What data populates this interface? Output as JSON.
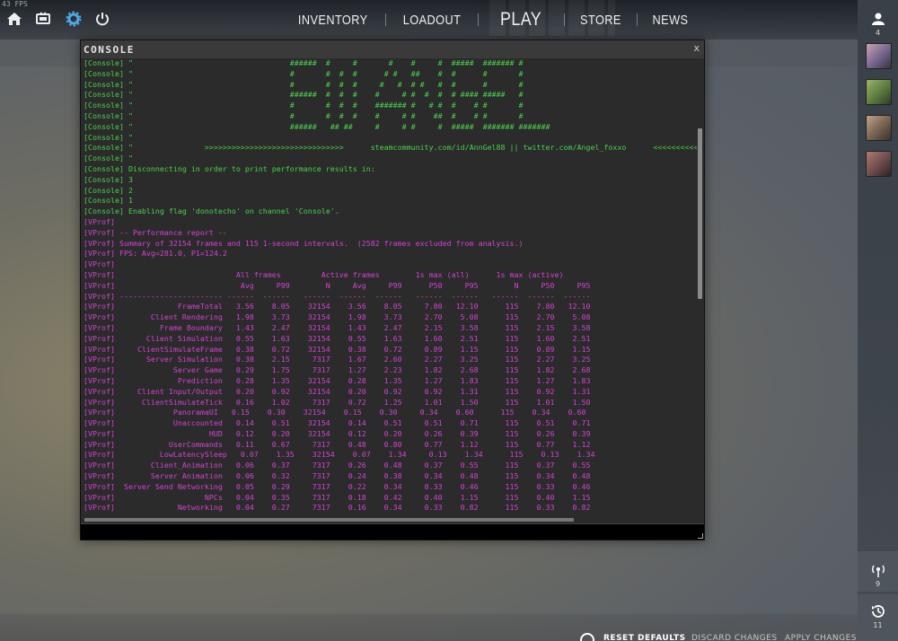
{
  "fps": "43 FPS",
  "nav": {
    "inventory": "INVENTORY",
    "loadout": "LOADOUT",
    "play": "PLAY",
    "store": "STORE",
    "news": "NEWS"
  },
  "topbar_icons": [
    "home-icon",
    "tv-icon",
    "gear-icon",
    "power-icon"
  ],
  "sidebar": {
    "friends_count": "4",
    "network_count": "9",
    "history_count": "11"
  },
  "console": {
    "title": "CONSOLE",
    "close": "x",
    "lines": [
      {
        "t": "c",
        "s": "[Console] \"                                   ######  #     #       #    #     #  #####  ####### #"
      },
      {
        "t": "c",
        "s": "[Console] \"                                   #       #  #  #      # #   ##    #  #      #       #"
      },
      {
        "t": "c",
        "s": "[Console] \"                                   #       #  #  #     #   #  # #   #  #      #       #"
      },
      {
        "t": "c",
        "s": "[Console] \"                                   ######  #  #  #    #     # #  #  #  # #### #####   #"
      },
      {
        "t": "c",
        "s": "[Console] \"                                   #       #  #  #    ####### #   # #  #    # #       #"
      },
      {
        "t": "c",
        "s": "[Console] \"                                   #       #  #  #    #     # #    ##  #    # #       #"
      },
      {
        "t": "c",
        "s": "[Console] \"                                   ######   ## ##     #     # #     #  #####  ####### #######"
      },
      {
        "t": "c",
        "s": "[Console] \""
      },
      {
        "t": "c",
        "s": "[Console] \"                >>>>>>>>>>>>>>>>>>>>>>>>>>>>>>>      steamcommunity.com/id/AnnGel88 || twitter.com/Angel_foxxo      <<<<<<<<<<<<"
      },
      {
        "t": "c",
        "s": "[Console] \""
      },
      {
        "t": "c",
        "s": "[Console] Disconnecting in order to print performance results in:"
      },
      {
        "t": "c",
        "s": "[Console] 3"
      },
      {
        "t": "c",
        "s": "[Console] 2"
      },
      {
        "t": "c",
        "s": "[Console] 1"
      },
      {
        "t": "c",
        "s": "[Console] Enabling flag 'donotecho' on channel 'Console'."
      },
      {
        "t": "v",
        "s": "[VProf]"
      },
      {
        "t": "v",
        "s": "[VProf] -- Performance report --"
      },
      {
        "t": "v",
        "s": "[VProf] Summary of 32154 frames and 115 1-second intervals.  (2582 frames excluded from analysis.)"
      },
      {
        "t": "v",
        "s": "[VProf] FPS: Avg=281.0, P1=124.2"
      },
      {
        "t": "v",
        "s": "[VProf]"
      },
      {
        "t": "v",
        "s": "[VProf]                           All frames         Active frames        1s max (all)      1s max (active)"
      },
      {
        "t": "v",
        "s": "[VProf]                            Avg     P99        N     Avg     P99      P50     P95        N     P50     P95"
      },
      {
        "t": "v",
        "s": "[VProf] ----------------------- ------  ------   ------  ------  ------   ------  ------   ------  ------  ------"
      },
      {
        "t": "v",
        "s": "[VProf]              FrameTotal   3.56    8.05    32154    3.56    8.05     7.80   12.10      115    7.80   12.10"
      },
      {
        "t": "v",
        "s": "[VProf]        Client Rendering   1.98    3.73    32154    1.98    3.73     2.70    5.08      115    2.70    5.08"
      },
      {
        "t": "v",
        "s": "[VProf]          Frame Boundary   1.43    2.47    32154    1.43    2.47     2.15    3.58      115    2.15    3.58"
      },
      {
        "t": "v",
        "s": "[VProf]       Client Simulation   0.55    1.63    32154    0.55    1.63     1.60    2.51      115    1.60    2.51"
      },
      {
        "t": "v",
        "s": "[VProf]     ClientSimulateFrame   0.38    0.72    32154    0.38    0.72     0.89    1.15      115    0.89    1.15"
      },
      {
        "t": "v",
        "s": "[VProf]       Server Simulation   0.38    2.15     7317    1.67    2.60     2.27    3.25      115    2.27    3.25"
      },
      {
        "t": "v",
        "s": "[VProf]             Server Game   0.29    1.75     7317    1.27    2.23     1.82    2.68      115    1.82    2.68"
      },
      {
        "t": "v",
        "s": "[VProf]              Prediction   0.28    1.35    32154    0.28    1.35     1.27    1.83      115    1.27    1.83"
      },
      {
        "t": "v",
        "s": "[VProf]     Client Input/Output   0.20    0.92    32154    0.20    0.92     0.92    1.31      115    0.92    1.31"
      },
      {
        "t": "v",
        "s": "[VProf]      ClientSimulateTick   0.16    1.02     7317    0.72    1.25     1.01    1.50      115    1.01    1.50"
      },
      {
        "t": "v",
        "s": "[VProf]             PanoramaUI   0.15    0.30    32154    0.15    0.30     0.34    0.60      115    0.34    0.60"
      },
      {
        "t": "v",
        "s": "[VProf]             Unaccounted   0.14    0.51    32154    0.14    0.51     0.51    0.71      115    0.51    0.71"
      },
      {
        "t": "v",
        "s": "[VProf]                     HUD   0.12    0.20    32154    0.12    0.20     0.26    0.39      115    0.26    0.39"
      },
      {
        "t": "v",
        "s": "[VProf]            UserCommands   0.11    0.67     7317    0.48    0.80     0.77    1.12      115    0.77    1.12"
      },
      {
        "t": "v",
        "s": "[VProf]          LowLatencySleep   0.07    1.35    32154    0.07    1.34     0.13    1.34      115    0.13    1.34"
      },
      {
        "t": "v",
        "s": "[VProf]        Client_Animation   0.06    0.37     7317    0.26    0.48     0.37    0.55      115    0.37    0.55"
      },
      {
        "t": "v",
        "s": "[VProf]        Server Animation   0.06    0.32     7317    0.24    0.38     0.34    0.48      115    0.34    0.48"
      },
      {
        "t": "v",
        "s": "[VProf]  Server Send Networking   0.05    0.29     7317    0.22    0.34     0.33    0.46      115    0.33    0.46"
      },
      {
        "t": "v",
        "s": "[VProf]                    NPCs   0.04    0.35     7317    0.18    0.42     0.40    1.15      115    0.40    1.15"
      },
      {
        "t": "v",
        "s": "[VProf]              Networking   0.04    0.27     7317    0.16    0.34     0.33    0.82      115    0.33    0.82"
      }
    ]
  },
  "bottom": {
    "reset": "RESET DEFAULTS",
    "discard": "DISCARD CHANGES",
    "apply": "APPLY CHANGES"
  },
  "colors": {
    "console_green": "#49d24b",
    "vprof_magenta": "#d542d5",
    "console_bg": "#2b2b2b"
  }
}
